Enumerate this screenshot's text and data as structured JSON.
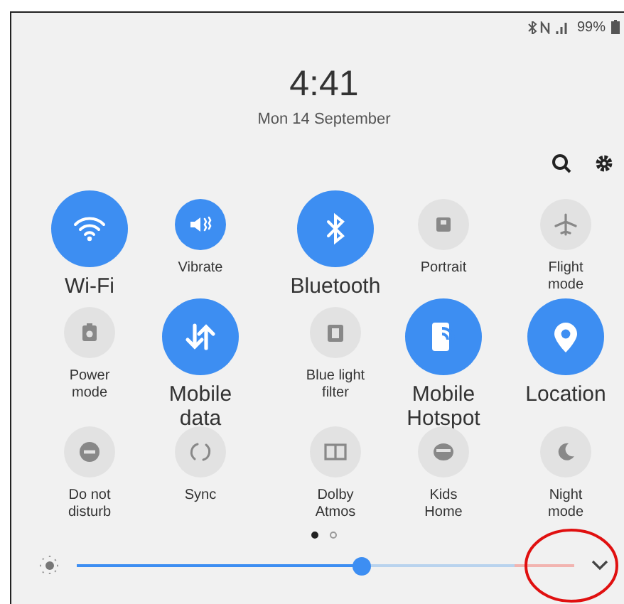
{
  "status_bar": {
    "battery": "99%"
  },
  "clock": {
    "time": "4:41",
    "date": "Mon 14 September"
  },
  "tiles": [
    {
      "label": "Wi-Fi",
      "kind": "large",
      "on": true
    },
    {
      "label": "Vibrate",
      "kind": "small",
      "on": true
    },
    {
      "label": "Bluetooth",
      "kind": "large",
      "on": true
    },
    {
      "label": "Portrait",
      "kind": "small",
      "on": false
    },
    {
      "label": "Flight mode",
      "kind": "small",
      "on": false
    },
    {
      "label": "Power mode",
      "kind": "small",
      "on": false
    },
    {
      "label": "Mobile data",
      "kind": "large",
      "on": true
    },
    {
      "label": "Blue light filter",
      "kind": "small",
      "on": false
    },
    {
      "label": "Mobile Hotspot",
      "kind": "large",
      "on": true
    },
    {
      "label": "Location",
      "kind": "large",
      "on": true
    },
    {
      "label": "Do not disturb",
      "kind": "small",
      "on": false
    },
    {
      "label": "Sync",
      "kind": "small",
      "on": false
    },
    {
      "label": "Dolby Atmos",
      "kind": "small",
      "on": false
    },
    {
      "label": "Kids Home",
      "kind": "small",
      "on": false
    },
    {
      "label": "Night mode",
      "kind": "small",
      "on": false
    }
  ],
  "pages": [
    {
      "selected": true
    },
    {
      "selected": false
    }
  ],
  "brightness": {
    "level": 0.57
  }
}
